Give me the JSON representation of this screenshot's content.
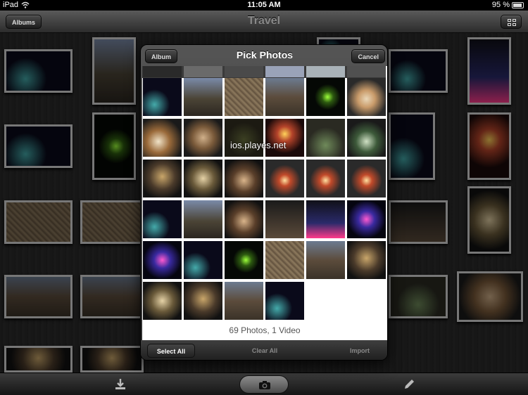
{
  "status": {
    "carrier": "iPad",
    "time": "11:05 AM",
    "battery": "95 %"
  },
  "nav": {
    "title": "Travel",
    "albums_label": "Albums"
  },
  "picker": {
    "title": "Pick Photos",
    "album_label": "Album",
    "cancel_label": "Cancel",
    "count_text": "69 Photos, 1 Video",
    "select_all": "Select All",
    "clear_all": "Clear All",
    "import": "Import"
  },
  "watermark": "ios.playes.net",
  "icons": {
    "wifi": "wifi-icon",
    "battery": "battery-icon",
    "grid": "grid-view-icon",
    "download": "download-icon",
    "camera": "camera-icon",
    "edit": "pencil-icon"
  },
  "colors": {
    "thumb_border": "#d9d9d9",
    "popover_bg": "#3a3a3a",
    "grid_bg": "#ffffff"
  }
}
